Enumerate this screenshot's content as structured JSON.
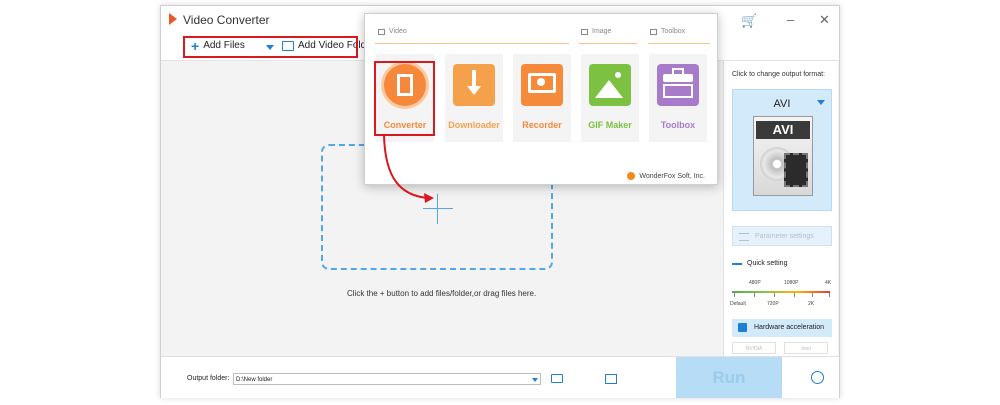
{
  "window": {
    "title": "Video Converter"
  },
  "toolbar": {
    "add_files": "Add Files",
    "add_video_folder": "Add Video Folder"
  },
  "main": {
    "hint": "Click the + button to add files/folder,or drag files here."
  },
  "popup": {
    "sections": {
      "video": "Video",
      "image": "Image",
      "toolbox": "Toolbox"
    },
    "tools": [
      {
        "label": "Converter",
        "icon": "film-icon",
        "color": "#f5883a"
      },
      {
        "label": "Downloader",
        "icon": "download-icon",
        "color": "#f5a14b"
      },
      {
        "label": "Recorder",
        "icon": "screen-record-icon",
        "color": "#f58a3a"
      },
      {
        "label": "GIF Maker",
        "icon": "image-icon",
        "color": "#7dc142"
      },
      {
        "label": "Toolbox",
        "icon": "toolbox-icon",
        "color": "#a77bca"
      }
    ],
    "copyright": "WonderFox Soft, Inc."
  },
  "right_panel": {
    "change_format_label": "Click to change output format:",
    "format": "AVI",
    "format_badge": "AVI",
    "parameter_settings": "Parameter settings",
    "quick_setting": "Quick setting",
    "scale_top": [
      "480P",
      "1080P",
      "4K"
    ],
    "scale_bottom": [
      "Default",
      "720P",
      "2K"
    ],
    "hardware_acceleration": "Hardware acceleration",
    "gpu": [
      "NVIDIA",
      "Intel"
    ]
  },
  "bottom": {
    "output_folder_label": "Output folder:",
    "output_folder_value": "D:\\New folder",
    "run": "Run"
  },
  "colors": {
    "accent": "#1f7fd6",
    "highlight": "#d9181f",
    "converter": "#f5883a"
  }
}
